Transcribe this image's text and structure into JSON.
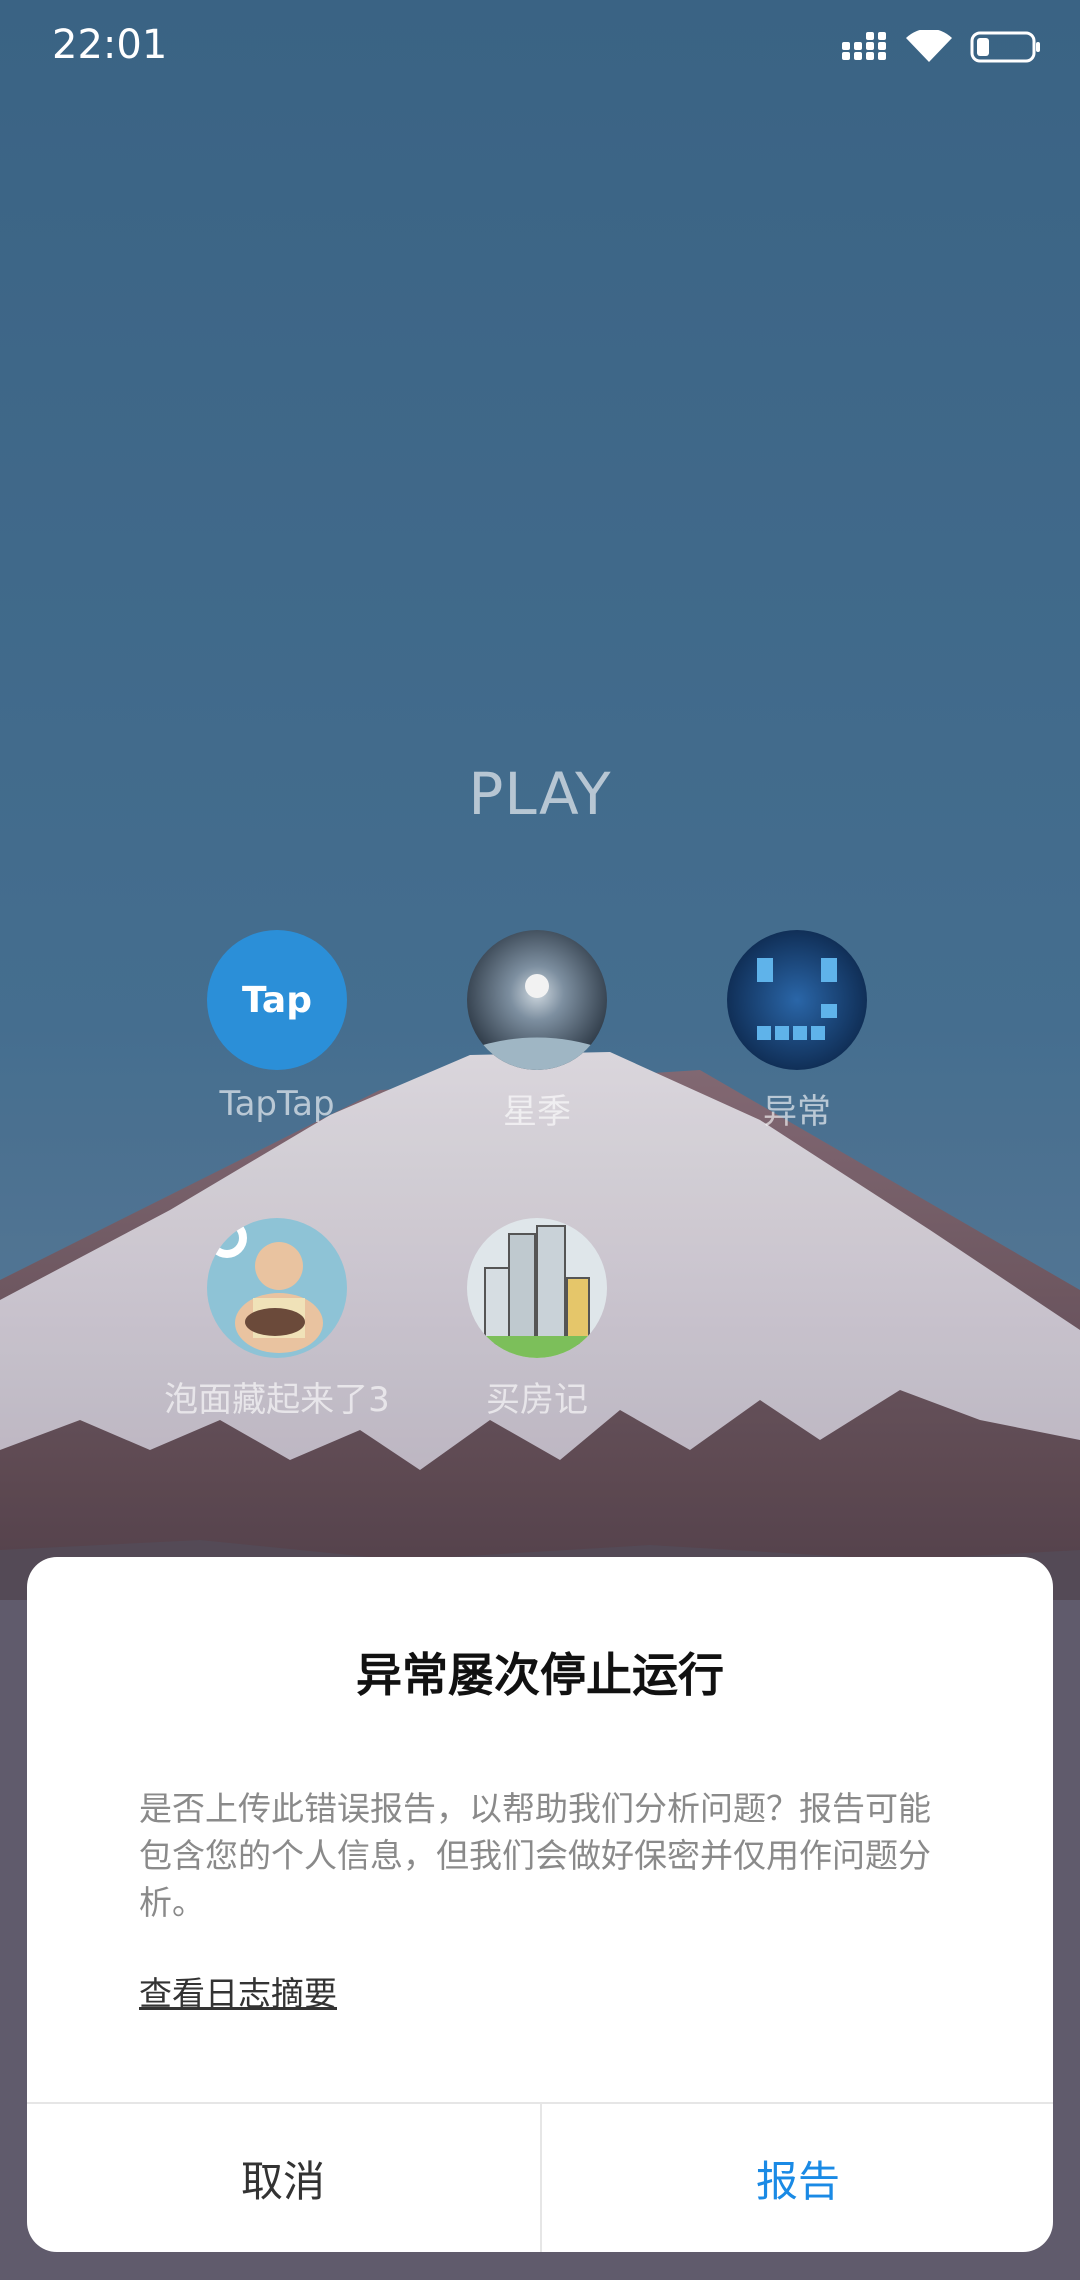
{
  "status_bar": {
    "time": "22:01",
    "icons": [
      "signal-icon",
      "wifi-icon",
      "battery-icon"
    ]
  },
  "folder": {
    "title": "PLAY",
    "apps": [
      {
        "label": "TapTap",
        "icon": "taptap-app-icon",
        "icon_text": "Tap"
      },
      {
        "label": "星季",
        "icon": "xingji-app-icon"
      },
      {
        "label": "异常",
        "icon": "yichang-app-icon"
      },
      {
        "label": "泡面藏起来了3",
        "icon": "paomian-app-icon"
      },
      {
        "label": "买房记",
        "icon": "maifangji-app-icon"
      }
    ]
  },
  "dialog": {
    "title": "异常屡次停止运行",
    "message": "是否上传此错误报告，以帮助我们分析问题？报告可能包含您的个人信息，但我们会做好保密并仅用作问题分析。",
    "link": "查看日志摘要",
    "cancel_label": "取消",
    "report_label": "报告"
  },
  "colors": {
    "sky": "#3c6688",
    "accent_blue": "#1a8ae5",
    "taptap_blue": "#2b8fd8"
  }
}
